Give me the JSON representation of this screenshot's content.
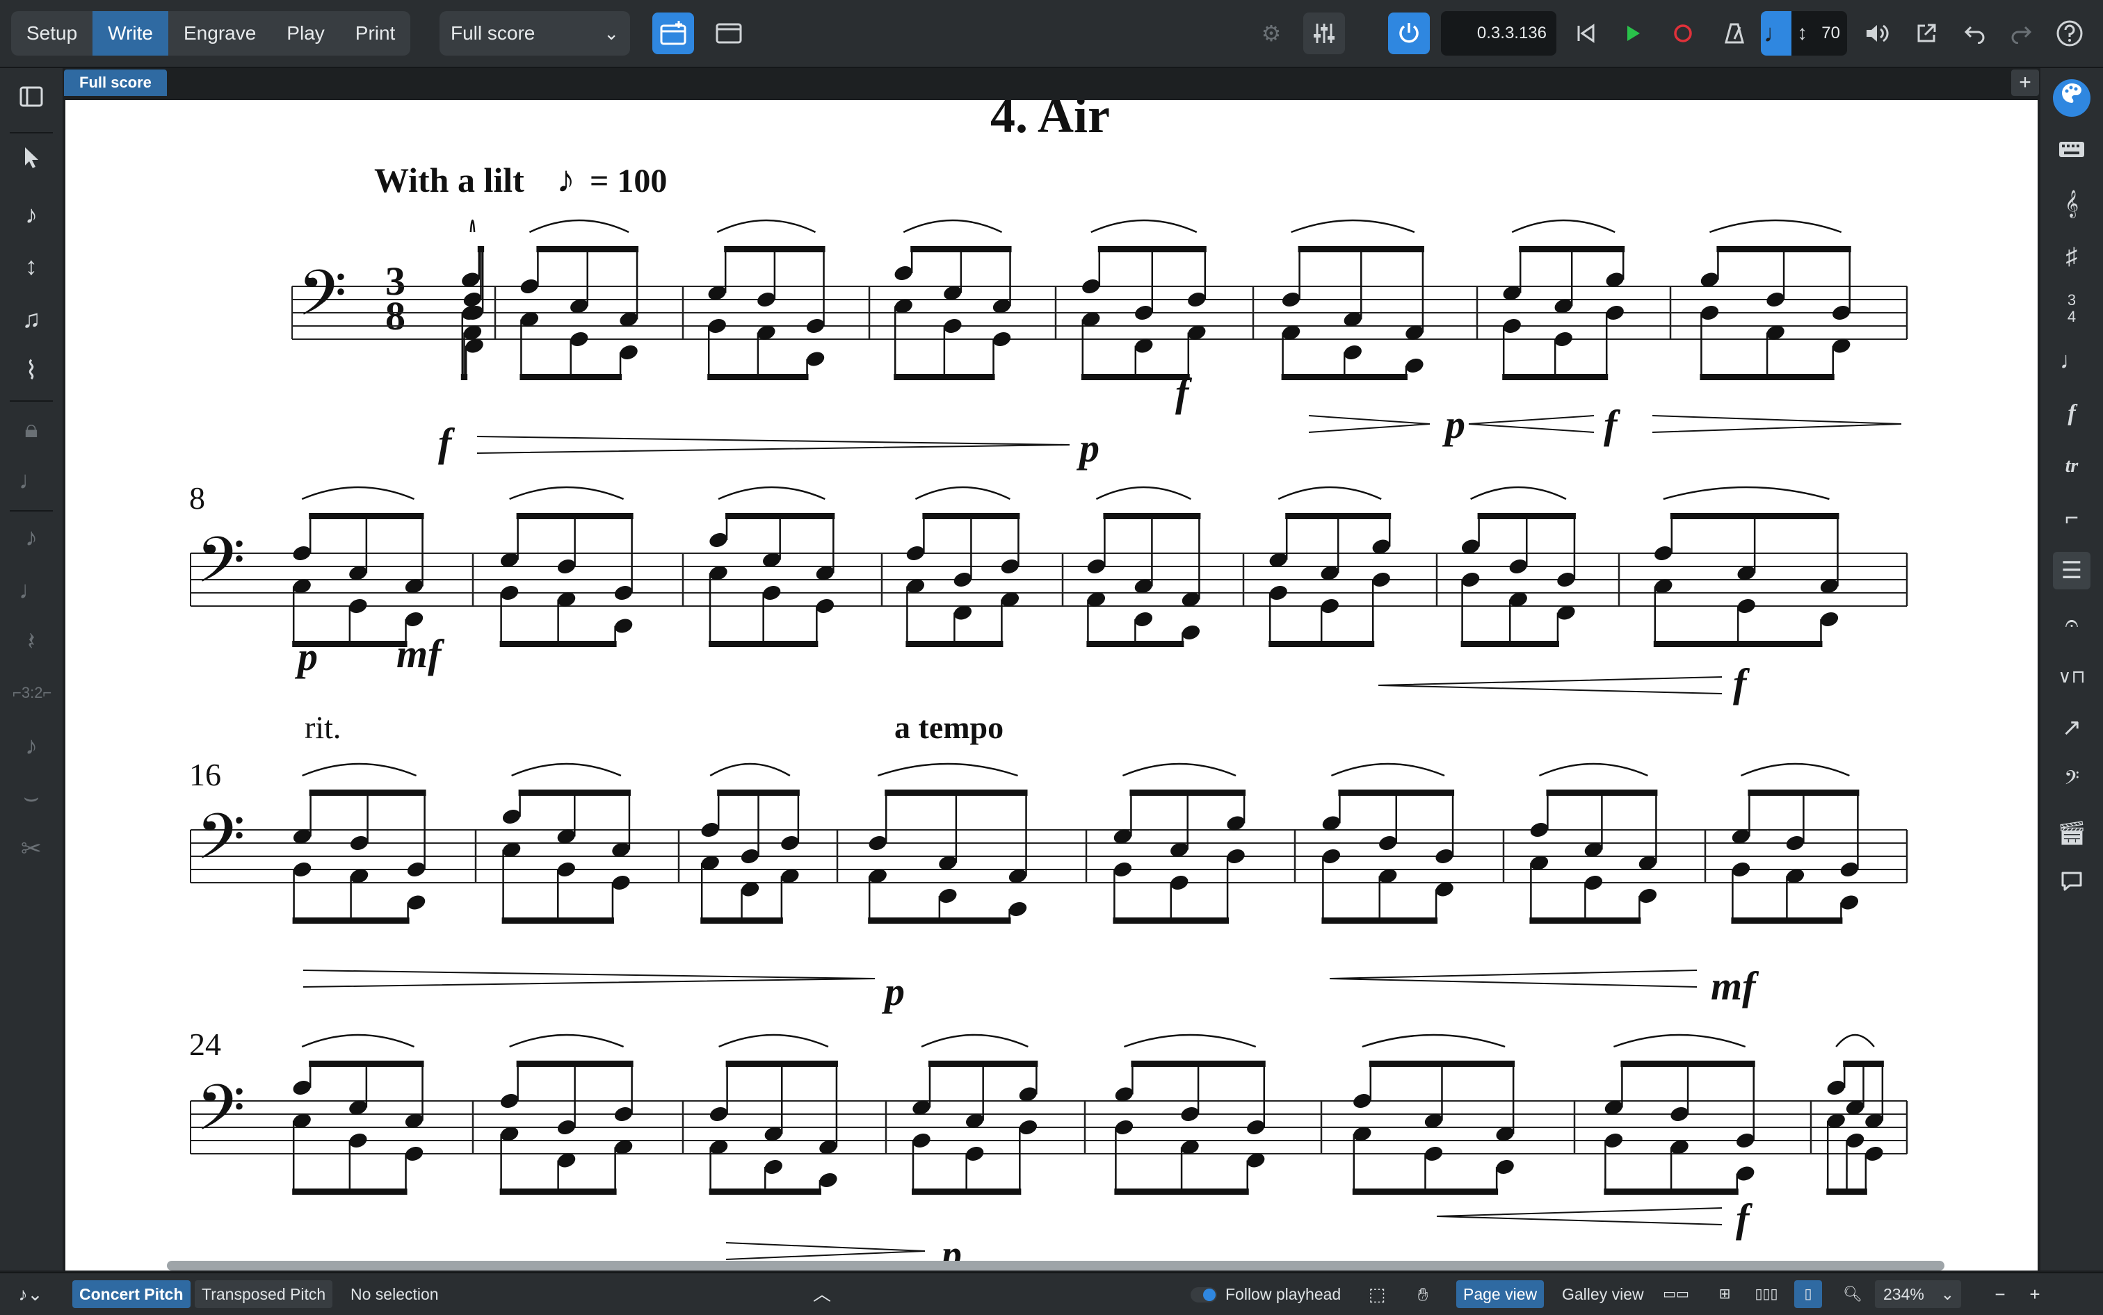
{
  "toolbar": {
    "modes": [
      "Setup",
      "Write",
      "Engrave",
      "Play",
      "Print"
    ],
    "active_mode": "Write",
    "layout_select": "Full score",
    "time_counter": "0.3.3.136",
    "tempo_value": "70"
  },
  "tabs": {
    "full_score": "Full score"
  },
  "score": {
    "title": "4. Air",
    "tempo_text": "With a lilt",
    "tempo_equals": "= 100",
    "time_signature": {
      "top": "3",
      "bottom": "8"
    },
    "bar_numbers": [
      "8",
      "16",
      "24"
    ],
    "rit": "rit.",
    "a_tempo": "a tempo",
    "dynamics": {
      "sys1": [
        "f",
        "p",
        "f"
      ],
      "sys2": [
        "f",
        "p",
        "p",
        "mf",
        "f"
      ],
      "sys3": [
        "p",
        "mf"
      ],
      "sys4": [
        "f",
        "p"
      ]
    }
  },
  "statusbar": {
    "concert_pitch": "Concert Pitch",
    "transposed_pitch": "Transposed Pitch",
    "selection": "No selection",
    "follow_playhead": "Follow playhead",
    "page_view": "Page view",
    "galley_view": "Galley view",
    "zoom": "234%"
  },
  "colors": {
    "accent": "#2f87e0",
    "active_tab": "#2f6aa2",
    "chrome": "#2a2e31"
  }
}
